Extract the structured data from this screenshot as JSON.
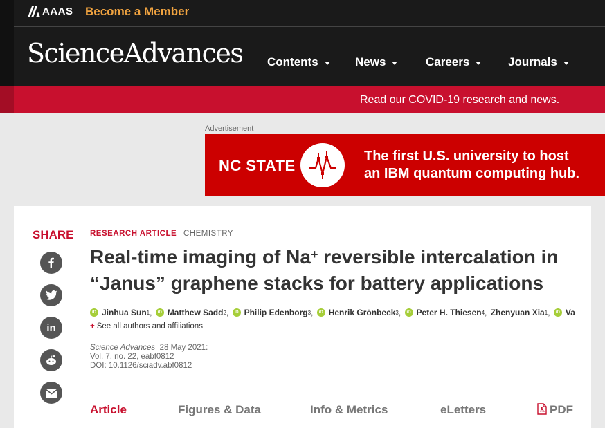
{
  "header": {
    "org_name": "AAAS",
    "member_cta": "Become a Member",
    "brand": "ScienceAdvances",
    "nav": [
      {
        "label": "Contents"
      },
      {
        "label": "News"
      },
      {
        "label": "Careers"
      },
      {
        "label": "Journals"
      }
    ]
  },
  "covid_banner": {
    "link_text": "Read our COVID-19 research and news."
  },
  "advertisement": {
    "label": "Advertisement",
    "sponsor": "NC STATE",
    "headline_line1": "The first U.S. university to host",
    "headline_line2": "an IBM quantum computing hub."
  },
  "article": {
    "share_label": "SHARE",
    "social_icons": [
      "facebook-icon",
      "twitter-icon",
      "linkedin-icon",
      "reddit-icon",
      "email-icon"
    ],
    "type": "RESEARCH ARTICLE",
    "subject": "CHEMISTRY",
    "title_part1": "Real-time imaging of Na",
    "title_sup": "+",
    "title_part2": " reversible intercalation in",
    "title_line2": "“Janus” graphene stacks for battery applications",
    "authors": [
      {
        "name": "Jinhua Sun",
        "aff": "1"
      },
      {
        "name": "Matthew Sadd",
        "aff": "2"
      },
      {
        "name": "Philip Edenborg",
        "aff": "3"
      },
      {
        "name": "Henrik Grönbeck",
        "aff": "3"
      },
      {
        "name": "Peter H. Thiesen",
        "aff": "4"
      },
      {
        "name": "Zhenyuan Xia",
        "aff": "1"
      },
      {
        "name": "Va…",
        "aff": ""
      }
    ],
    "see_all": "See all authors and affiliations",
    "journal": "Science Advances",
    "date": "28 May 2021:",
    "volume": "Vol. 7, no. 22, eabf0812",
    "doi": "DOI: 10.1126/sciadv.abf0812",
    "tabs": [
      "Article",
      "Figures & Data",
      "Info & Metrics",
      "eLetters",
      "PDF"
    ]
  },
  "colors": {
    "brand_red": "#c8102e",
    "accent_orange": "#f0a340",
    "orcid_green": "#a6ce39"
  }
}
